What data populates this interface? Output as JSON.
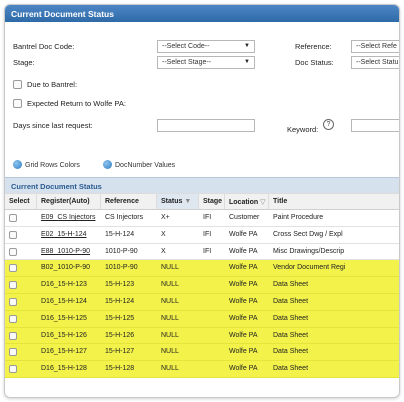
{
  "panel": {
    "title": "Current Document Status"
  },
  "form": {
    "bantrel_doc_code_label": "Bantrel Doc Code:",
    "bantrel_doc_code_value": "--Select Code--",
    "stage_label": "Stage:",
    "stage_value": "--Select Stage--",
    "reference_label": "Reference:",
    "reference_value": "--Select Refe",
    "doc_status_label": "Doc Status:",
    "doc_status_value": "--Select Statu",
    "due_to_bantrel_label": "Due to Bantrel:",
    "expected_return_label": "Expected Return to Wolfe PA:",
    "days_since_label": "Days since last request:",
    "keyword_label": "Keyword:",
    "help_glyph": "?"
  },
  "links": {
    "grid_rows_colors": "Grid Rows Colors",
    "docnumber_values": "DocNumber Values"
  },
  "grid": {
    "title": "Current Document Status",
    "columns": [
      "Select",
      "Register(Auto)",
      "Reference",
      "Status",
      "Stage",
      "Location",
      "Title"
    ],
    "sort_glyph": "▼",
    "filter_glyph": "▽",
    "rows": [
      {
        "register": "E09_CS Injectors",
        "reference": "CS Injectors",
        "status": "X+",
        "stage": "IFI",
        "location": "Customer",
        "title": "Paint Procedure",
        "highlight": false
      },
      {
        "register": "E02_15-H-124",
        "reference": "15-H-124",
        "status": "X",
        "stage": "IFI",
        "location": "Wolfe PA",
        "title": "Cross Sect Dwg / Expl",
        "highlight": false
      },
      {
        "register": "E88_1010-P-90",
        "reference": "1010-P-90",
        "status": "X",
        "stage": "IFI",
        "location": "Wolfe PA",
        "title": "Misc Drawings/Descrip",
        "highlight": false
      },
      {
        "register": "B02_1010-P-90",
        "reference": "1010-P-90",
        "status": "NULL",
        "stage": "",
        "location": "Wolfe PA",
        "title": "Vendor Document Regi",
        "highlight": true
      },
      {
        "register": "D16_15-H-123",
        "reference": "15-H-123",
        "status": "NULL",
        "stage": "",
        "location": "Wolfe PA",
        "title": "Data Sheet",
        "highlight": true
      },
      {
        "register": "D16_15-H-124",
        "reference": "15-H-124",
        "status": "NULL",
        "stage": "",
        "location": "Wolfe PA",
        "title": "Data Sheet",
        "highlight": true
      },
      {
        "register": "D16_15-H-125",
        "reference": "15-H-125",
        "status": "NULL",
        "stage": "",
        "location": "Wolfe PA",
        "title": "Data Sheet",
        "highlight": true
      },
      {
        "register": "D16_15-H-126",
        "reference": "15-H-126",
        "status": "NULL",
        "stage": "",
        "location": "Wolfe PA",
        "title": "Data Sheet",
        "highlight": true
      },
      {
        "register": "D16_15-H-127",
        "reference": "15-H-127",
        "status": "NULL",
        "stage": "",
        "location": "Wolfe PA",
        "title": "Data Sheet",
        "highlight": true
      },
      {
        "register": "D16_15-H-128",
        "reference": "15-H-128",
        "status": "NULL",
        "stage": "",
        "location": "Wolfe PA",
        "title": "Data Sheet",
        "highlight": true
      }
    ]
  },
  "colors": {
    "title_bar": "#2f6aa8",
    "highlight_row": "#f2f24a",
    "grid_title_bg": "#d6e1ee"
  }
}
